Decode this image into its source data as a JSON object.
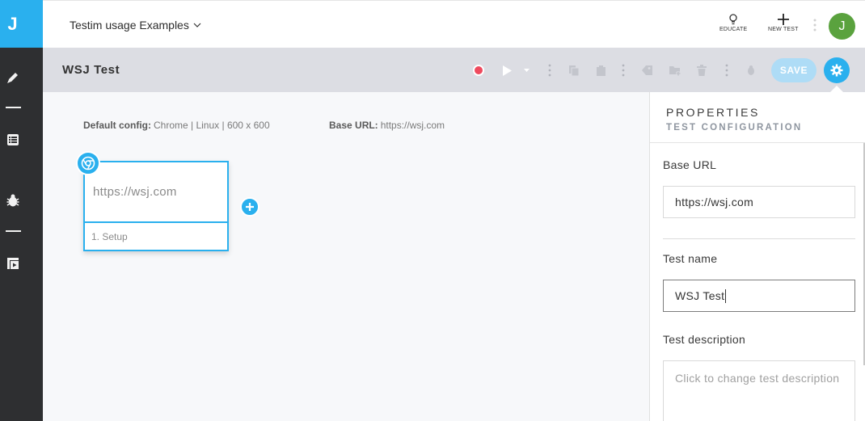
{
  "app": {
    "logo_letter": "J"
  },
  "header": {
    "project_name": "Testim usage Examples",
    "educate_label": "EDUCATE",
    "new_test_label": "NEW TEST",
    "avatar_initial": "J"
  },
  "toolbar": {
    "test_title": "WSJ Test",
    "save_label": "SAVE"
  },
  "canvas": {
    "default_config_label": "Default config:",
    "default_config_value": "Chrome | Linux | 600 x 600",
    "base_url_label": "Base URL:",
    "base_url_value": "https://wsj.com",
    "step": {
      "url": "https://wsj.com",
      "label": "1. Setup"
    }
  },
  "properties": {
    "title": "PROPERTIES",
    "subtitle": "TEST CONFIGURATION",
    "base_url_label": "Base URL",
    "base_url_value": "https://wsj.com",
    "test_name_label": "Test name",
    "test_name_value": "WSJ Test",
    "description_label": "Test description",
    "description_placeholder": "Click to change test description"
  },
  "colors": {
    "accent": "#2ab0ee",
    "rail": "#2e2f31",
    "toolbar": "#dcdde3",
    "record": "#ef4a5e",
    "avatar": "#5aa23e"
  }
}
